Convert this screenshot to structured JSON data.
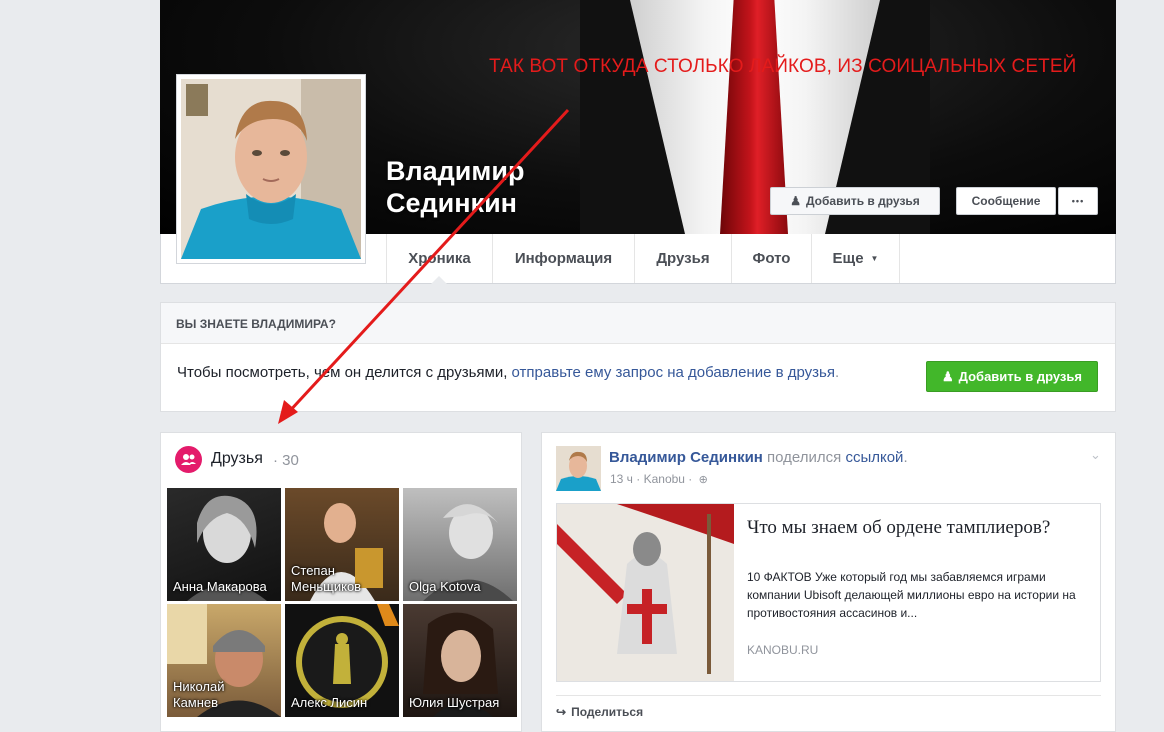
{
  "cover": {
    "annotation": "ТАК ВОТ ОТКУДА СТОЛЬКО ЛАЙКОВ, ИЗ СОИЦАЛЬНЫХ СЕТЕЙ",
    "annotation_color": "#e41b1b",
    "profile_name_line1": "Владимир",
    "profile_name_line2": "Сединкин",
    "add_friend_label": "Добавить в друзья",
    "message_label": "Сообщение",
    "more_label": "•••"
  },
  "tabs": [
    {
      "label": "Хроника"
    },
    {
      "label": "Информация"
    },
    {
      "label": "Друзья"
    },
    {
      "label": "Фото"
    },
    {
      "label": "Еще"
    }
  ],
  "know": {
    "title": "ВЫ ЗНАЕТЕ ВЛАДИМИРА?",
    "text": "Чтобы посмотреть, чем он делится с друзьями, ",
    "link": "отправьте ему запрос на добавление в друзья",
    "text_end": ".",
    "button_label": "Добавить в друзья",
    "button_color": "#42b72a"
  },
  "friends": {
    "title": "Друзья",
    "count": "· 30",
    "items": [
      {
        "name": "Анна Макарова"
      },
      {
        "name": "Степан Меньщиков"
      },
      {
        "name": "Olga Kotova"
      },
      {
        "name": "Николай Камнев"
      },
      {
        "name": "Алекс Лисин"
      },
      {
        "name": "Юлия Шустрая"
      }
    ]
  },
  "post": {
    "author": "Владимир Сединкин",
    "action": " поделился ",
    "link_word": "ссылкой",
    "action_end": ".",
    "meta": "13 ч · Kanobu ·",
    "card_title": "Что мы знаем об ордене тамплиеров?",
    "card_desc": "10 ФАКТОВ Уже который год мы забавляемся играми компании Ubisoft делающей миллионы евро на истории на противостояния ассасинов и...",
    "card_domain": "KANOBU.RU",
    "share_label": "Поделиться"
  },
  "colors": {
    "link": "#365899",
    "page_bg": "#e9ebee"
  }
}
